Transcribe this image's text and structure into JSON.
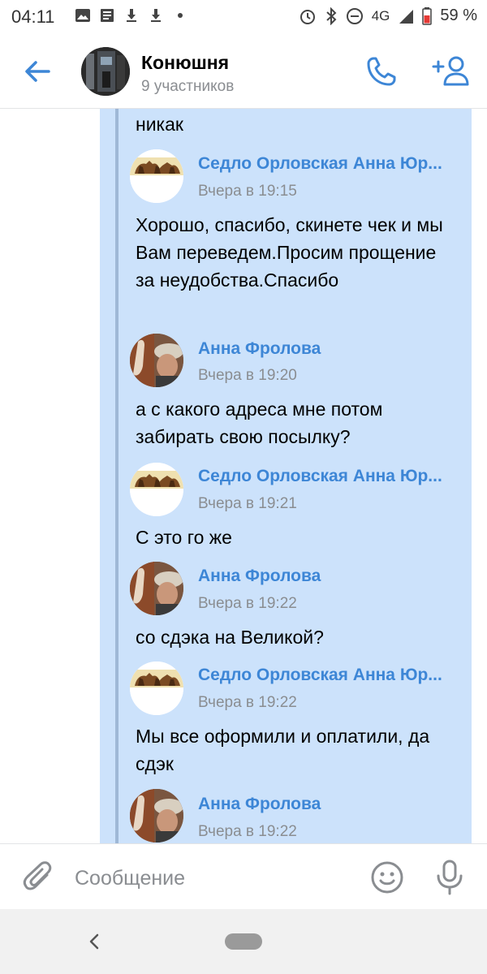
{
  "status_bar": {
    "time": "04:11",
    "network": "4G",
    "battery": "59 %",
    "icons_left": [
      "image-icon",
      "news-icon",
      "download-icon",
      "download-icon",
      "dot-icon"
    ],
    "icons_right": [
      "alarm-icon",
      "bluetooth-icon",
      "dnd-icon",
      "signal-icon",
      "battery-icon"
    ]
  },
  "header": {
    "title": "Конюшня",
    "subtitle": "9 участников"
  },
  "messages": [
    {
      "type": "text",
      "text": "никак"
    },
    {
      "type": "author",
      "name": "Седло Орловская Анна Юр...",
      "time": "Вчера в 19:15",
      "avatar": "horse"
    },
    {
      "type": "text",
      "text": "Хорошо, спасибо, скинете чек и мы Вам переведем.Просим прощение за неудобства.Спасибо"
    },
    {
      "type": "author",
      "name": "Анна Фролова",
      "time": "Вчера в 19:20",
      "avatar": "photo"
    },
    {
      "type": "text",
      "text": "а с какого адреса мне потом забирать свою посылку?"
    },
    {
      "type": "author",
      "name": "Седло Орловская Анна Юр...",
      "time": "Вчера в 19:21",
      "avatar": "horse"
    },
    {
      "type": "text",
      "text": "С это го же"
    },
    {
      "type": "author",
      "name": "Анна Фролова",
      "time": "Вчера в 19:22",
      "avatar": "photo"
    },
    {
      "type": "text",
      "text": "со сдэка на Великой?"
    },
    {
      "type": "author",
      "name": "Седло Орловская Анна Юр...",
      "time": "Вчера в 19:22",
      "avatar": "horse"
    },
    {
      "type": "text",
      "text": "Мы все оформили и оплатили, да сдэк"
    },
    {
      "type": "author",
      "name": "Анна Фролова",
      "time": "Вчера в 19:22",
      "avatar": "photo"
    }
  ],
  "composer": {
    "placeholder": "Сообщение"
  },
  "colors": {
    "accent": "#3d86d6",
    "forward_bg": "#cce2fb",
    "forward_bar": "#9fb8d6",
    "muted_text": "#8a8d91"
  }
}
